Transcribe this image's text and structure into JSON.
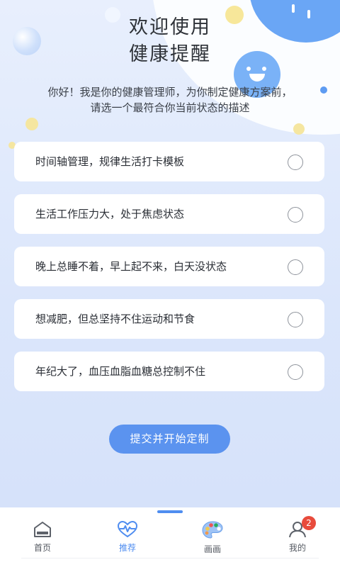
{
  "header": {
    "title_line1": "欢迎使用",
    "title_line2": "健康提醒"
  },
  "intro": {
    "line1": "你好！我是你的健康管理师，为你制定健康方案前，",
    "line2": "请选一个最符合你当前状态的描述"
  },
  "options": [
    {
      "label": "时间轴管理，规律生活打卡模板",
      "selected": false
    },
    {
      "label": "生活工作压力大，处于焦虑状态",
      "selected": false
    },
    {
      "label": "晚上总睡不着，早上起不来，白天没状态",
      "selected": false
    },
    {
      "label": "想减肥，但总坚持不住运动和节食",
      "selected": false
    },
    {
      "label": "年纪大了，血压血脂血糖总控制不住",
      "selected": false
    }
  ],
  "submit": {
    "label": "提交并开始定制"
  },
  "tabbar": {
    "active": "推荐",
    "tabs": [
      {
        "label": "首页",
        "icon": "home-icon"
      },
      {
        "label": "推荐",
        "icon": "heartbeat-icon"
      },
      {
        "label": "画画",
        "icon": "palette-icon"
      },
      {
        "label": "我的",
        "icon": "profile-icon",
        "badge": "2"
      }
    ]
  },
  "colors": {
    "accent": "#5b93ef",
    "background": "#dfe9fb",
    "badge": "#e84b3c"
  }
}
